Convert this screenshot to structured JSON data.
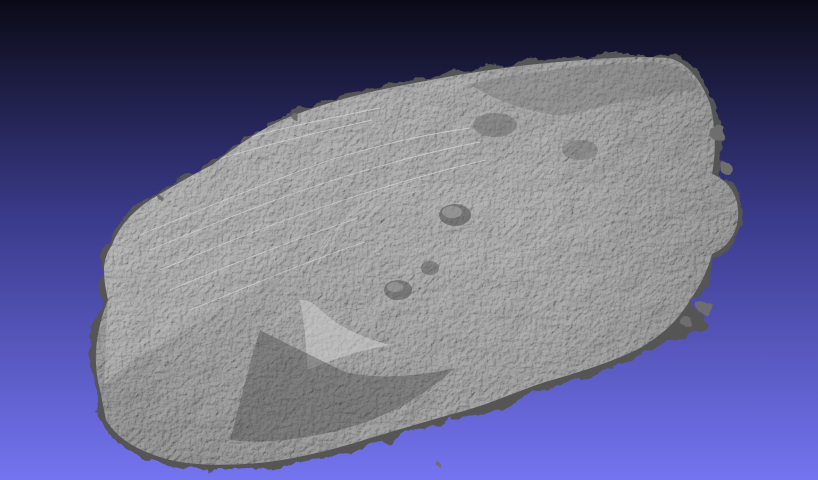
{
  "viewer": {
    "background": {
      "top_color": "#0a0a16",
      "bottom_color": "#7474f0"
    },
    "model": {
      "description_icon": "rock-mesh-icon",
      "shading": "flat-grey-headlight",
      "base_color": "#9a9a9a",
      "dark_color": "#2e2e2e",
      "light_color": "#d8d8d8"
    }
  }
}
